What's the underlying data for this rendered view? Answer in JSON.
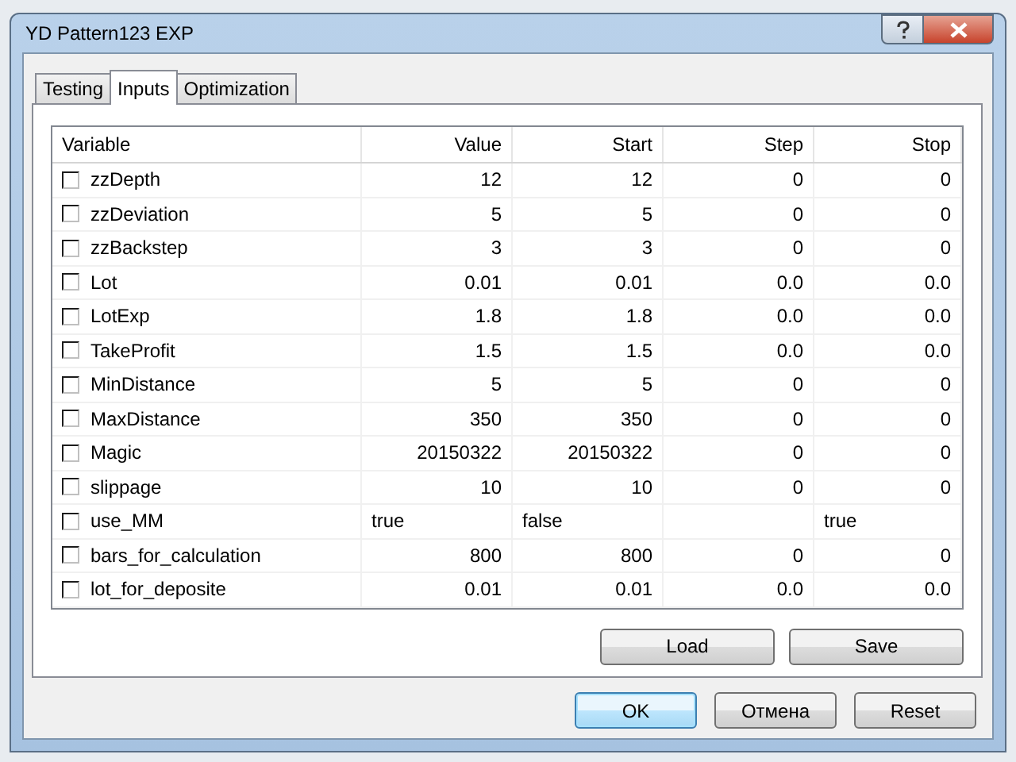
{
  "window": {
    "title": "YD Pattern123 EXP"
  },
  "tabs": [
    {
      "label": "Testing",
      "selected": false
    },
    {
      "label": "Inputs",
      "selected": true
    },
    {
      "label": "Optimization",
      "selected": false
    }
  ],
  "table": {
    "columns": [
      "Variable",
      "Value",
      "Start",
      "Step",
      "Stop"
    ],
    "rows": [
      {
        "name": "zzDepth",
        "checked": false,
        "kind": "number",
        "value": "12",
        "start": "12",
        "step": "0",
        "stop": "0"
      },
      {
        "name": "zzDeviation",
        "checked": false,
        "kind": "number",
        "value": "5",
        "start": "5",
        "step": "0",
        "stop": "0"
      },
      {
        "name": "zzBackstep",
        "checked": false,
        "kind": "number",
        "value": "3",
        "start": "3",
        "step": "0",
        "stop": "0"
      },
      {
        "name": "Lot",
        "checked": false,
        "kind": "number",
        "value": "0.01",
        "start": "0.01",
        "step": "0.0",
        "stop": "0.0"
      },
      {
        "name": "LotExp",
        "checked": false,
        "kind": "number",
        "value": "1.8",
        "start": "1.8",
        "step": "0.0",
        "stop": "0.0"
      },
      {
        "name": "TakeProfit",
        "checked": false,
        "kind": "number",
        "value": "1.5",
        "start": "1.5",
        "step": "0.0",
        "stop": "0.0"
      },
      {
        "name": "MinDistance",
        "checked": false,
        "kind": "number",
        "value": "5",
        "start": "5",
        "step": "0",
        "stop": "0"
      },
      {
        "name": "MaxDistance",
        "checked": false,
        "kind": "number",
        "value": "350",
        "start": "350",
        "step": "0",
        "stop": "0"
      },
      {
        "name": "Magic",
        "checked": false,
        "kind": "number",
        "value": "20150322",
        "start": "20150322",
        "step": "0",
        "stop": "0"
      },
      {
        "name": "slippage",
        "checked": false,
        "kind": "number",
        "value": "10",
        "start": "10",
        "step": "0",
        "stop": "0"
      },
      {
        "name": "use_MM",
        "checked": false,
        "kind": "bool",
        "value": "true",
        "start": "false",
        "stop": "true"
      },
      {
        "name": "bars_for_calculation",
        "checked": false,
        "kind": "number",
        "value": "800",
        "start": "800",
        "step": "0",
        "stop": "0"
      },
      {
        "name": "lot_for_deposite",
        "checked": false,
        "kind": "number",
        "value": "0.01",
        "start": "0.01",
        "step": "0.0",
        "stop": "0.0"
      }
    ]
  },
  "panel_buttons": [
    "Load",
    "Save"
  ],
  "dialog_buttons": [
    {
      "label": "OK",
      "selected": true
    },
    {
      "label": "Отмена",
      "selected": false
    },
    {
      "label": "Reset",
      "selected": false
    }
  ]
}
